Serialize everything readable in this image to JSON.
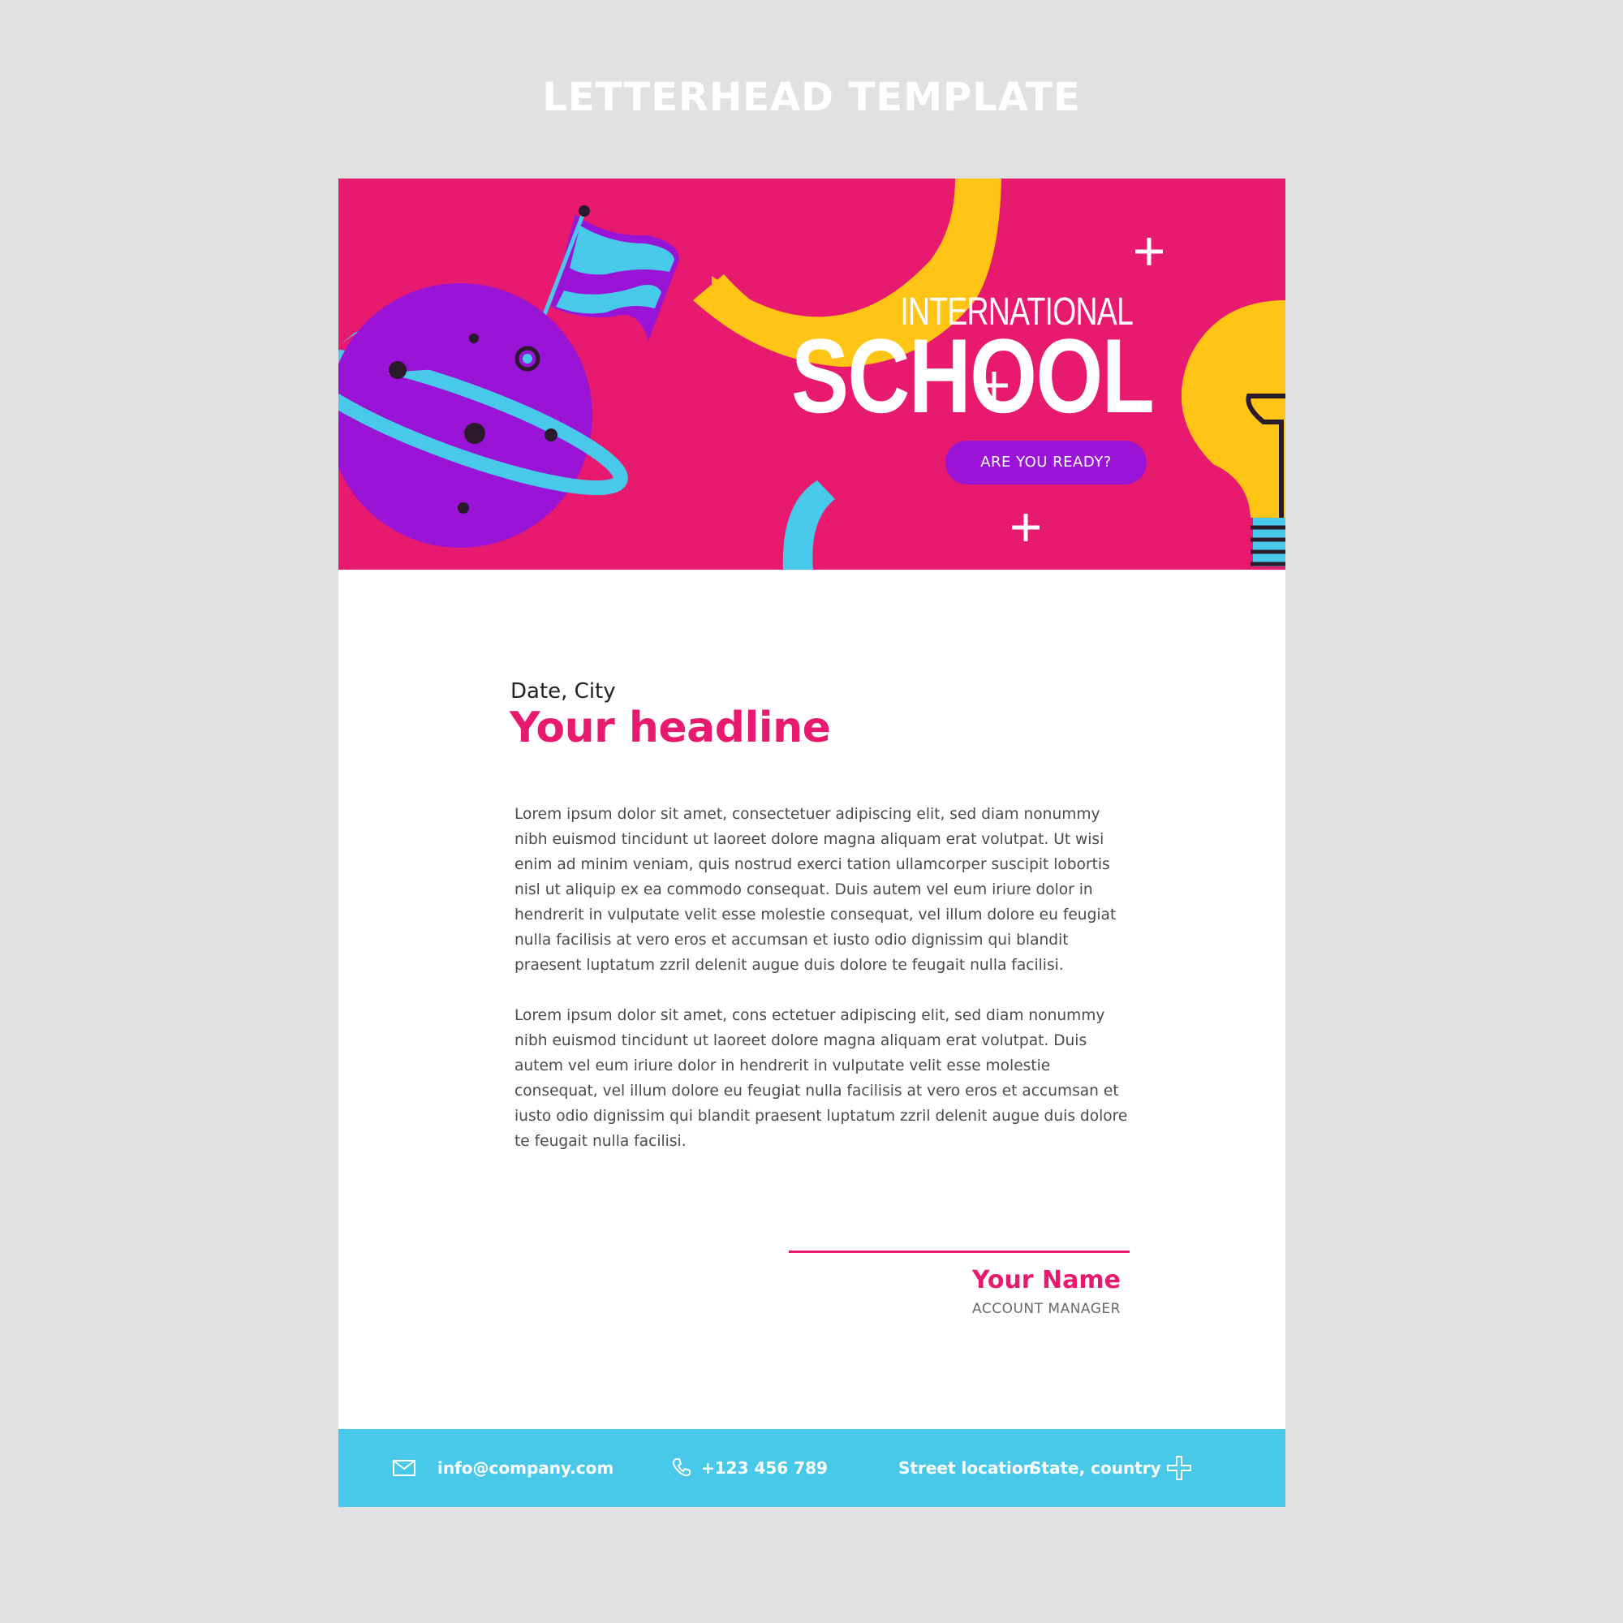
{
  "page_heading": "LETTERHEAD TEMPLATE",
  "banner": {
    "brand_top": "INTERNATIONAL",
    "brand_main": "SCHOOL",
    "tagline_button": "ARE YOU READY?"
  },
  "letter": {
    "date_city": "Date, City",
    "headline": "Your headline",
    "paragraphs": [
      "Lorem ipsum dolor sit amet, consectetuer adipiscing elit, sed diam nonummy nibh euismod tincidunt ut laoreet dolore magna aliquam erat volutpat. Ut wisi enim ad minim veniam, quis nostrud exerci tation ullamcorper suscipit lobortis nisl ut aliquip ex ea commodo consequat. Duis autem vel eum iriure dolor in hendrerit in vulputate velit esse molestie consequat, vel illum dolore eu feugiat nulla facilisis at vero eros et accumsan et iusto odio dignissim qui blandit praesent luptatum zzril delenit augue duis dolore te feugait nulla facilisi.",
      "Lorem ipsum dolor sit amet, cons ectetuer adipiscing elit, sed diam nonummy nibh euismod tincidunt ut laoreet dolore magna aliquam erat volutpat. Duis autem vel eum iriure dolor in hendrerit in vulputate velit esse molestie consequat, vel illum dolore eu feugiat nulla facilisis at vero eros et accumsan et iusto odio dignissim qui blandit praesent luptatum zzril delenit augue duis dolore te feugait nulla facilisi."
    ],
    "signature_name": "Your Name",
    "signature_title": "ACCOUNT MANAGER"
  },
  "footer": {
    "email": "info@company.com",
    "phone": "+123 456 789",
    "street": "Street location",
    "state_country": "State, country"
  },
  "icons": {
    "email": "mail-icon",
    "phone": "phone-icon",
    "decor": "plus-icon"
  },
  "colors": {
    "background": "#e1e1e1",
    "banner_pink": "#e81a6f",
    "purple": "#9a14d8",
    "yellow": "#ffc414",
    "cyan": "#49c9e9",
    "text_gray": "#4a4a4a"
  }
}
